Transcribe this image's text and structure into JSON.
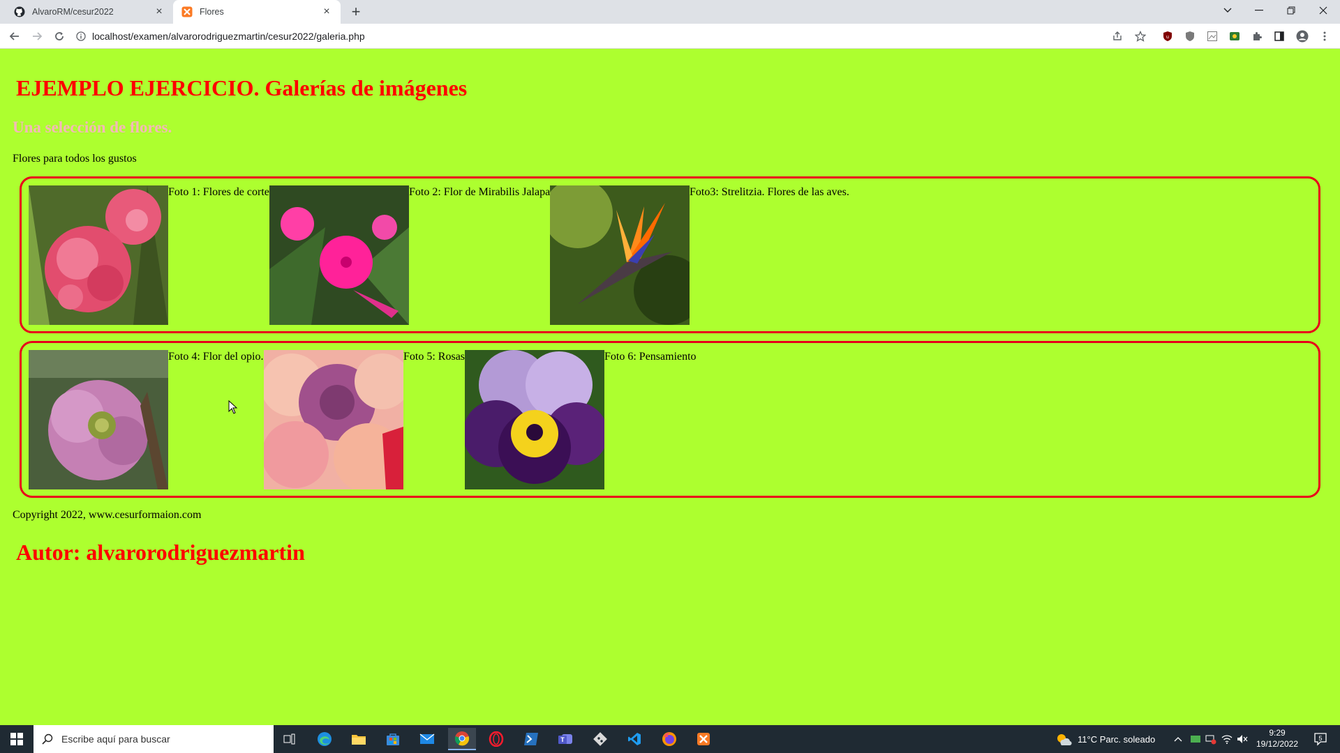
{
  "browser": {
    "tabs": [
      {
        "title": "AlvaroRM/cesur2022",
        "icon": "github-icon"
      },
      {
        "title": "Flores",
        "icon": "xampp-icon"
      }
    ],
    "url": "localhost/examen/alvarorodriguezmartin/cesur2022/galeria.php"
  },
  "page": {
    "heading": "EJEMPLO EJERCICIO. Galerías de imágenes",
    "subheading": "Una selección de flores.",
    "intro": "Flores para todos los gustos",
    "galleries": [
      {
        "photos": [
          {
            "caption": "Foto 1: Flores de corte",
            "subject": "hydrangea-photo"
          },
          {
            "caption": "Foto 2: Flor de Mirabilis Jalapa",
            "subject": "mirabilis-photo"
          },
          {
            "caption": "Foto3: Strelitzia. Flores de las aves.",
            "subject": "strelitzia-photo"
          }
        ]
      },
      {
        "photos": [
          {
            "caption": "Foto 4: Flor del opio.",
            "subject": "poppy-photo"
          },
          {
            "caption": "Foto 5: Rosas",
            "subject": "roses-photo"
          },
          {
            "caption": "Foto 6: Pensamiento",
            "subject": "pansy-photo"
          }
        ]
      }
    ],
    "copyright": "Copyright 2022, www.cesurformaion.com",
    "author": "Autor: alvarorodriguezmartin"
  },
  "taskbar": {
    "search_placeholder": "Escribe aquí para buscar",
    "weather": "11°C  Parc. soleado",
    "time": "9:29",
    "date": "19/12/2022",
    "notifications": "5"
  },
  "colors": {
    "page_background": "#adff2f",
    "heading": "#ff0000",
    "subheading": "#f4b8b8",
    "gallery_border": "#e8001a"
  }
}
